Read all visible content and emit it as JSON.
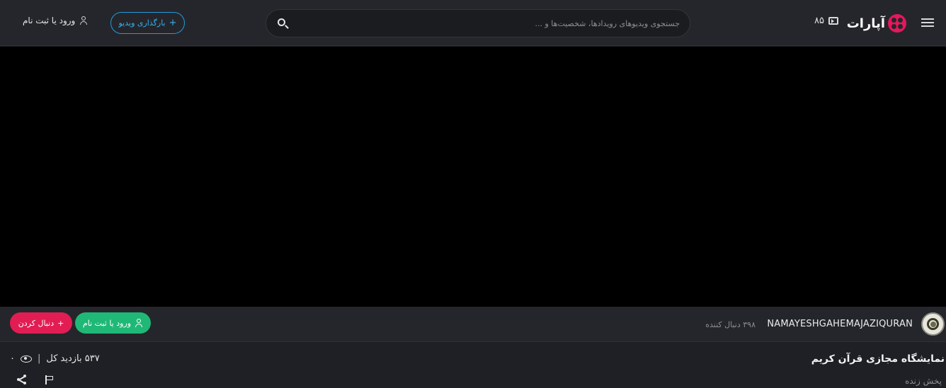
{
  "header": {
    "logo_text": "آپارات",
    "credit_value": "۸۵",
    "search_placeholder": "جستجوی ویدیوهای رویدادها، شخصیت‌ها و ...",
    "upload_label": "بارگذاری ویدیو",
    "upload_plus": "+",
    "login_label": "ورود یا ثبت نام"
  },
  "channel": {
    "name": "NAMAYESHGAHEMAJAZIQURAN",
    "followers": "۳۹۸ دنبال کننده",
    "login_label": "ورود یا ثبت نام",
    "follow_label": "دنبال کردن",
    "follow_plus": "+"
  },
  "video": {
    "title": "نمایشگاه مجازی قرآن کریم",
    "subtitle": "پخش زنده",
    "total_views": "۵۳۷ بازدید کل",
    "separator": "|",
    "live_viewers": "۰"
  },
  "colors": {
    "accent_blue": "#1e9ce0",
    "green": "#1fb876",
    "red": "#e11d53",
    "brand": "#e6175c"
  }
}
